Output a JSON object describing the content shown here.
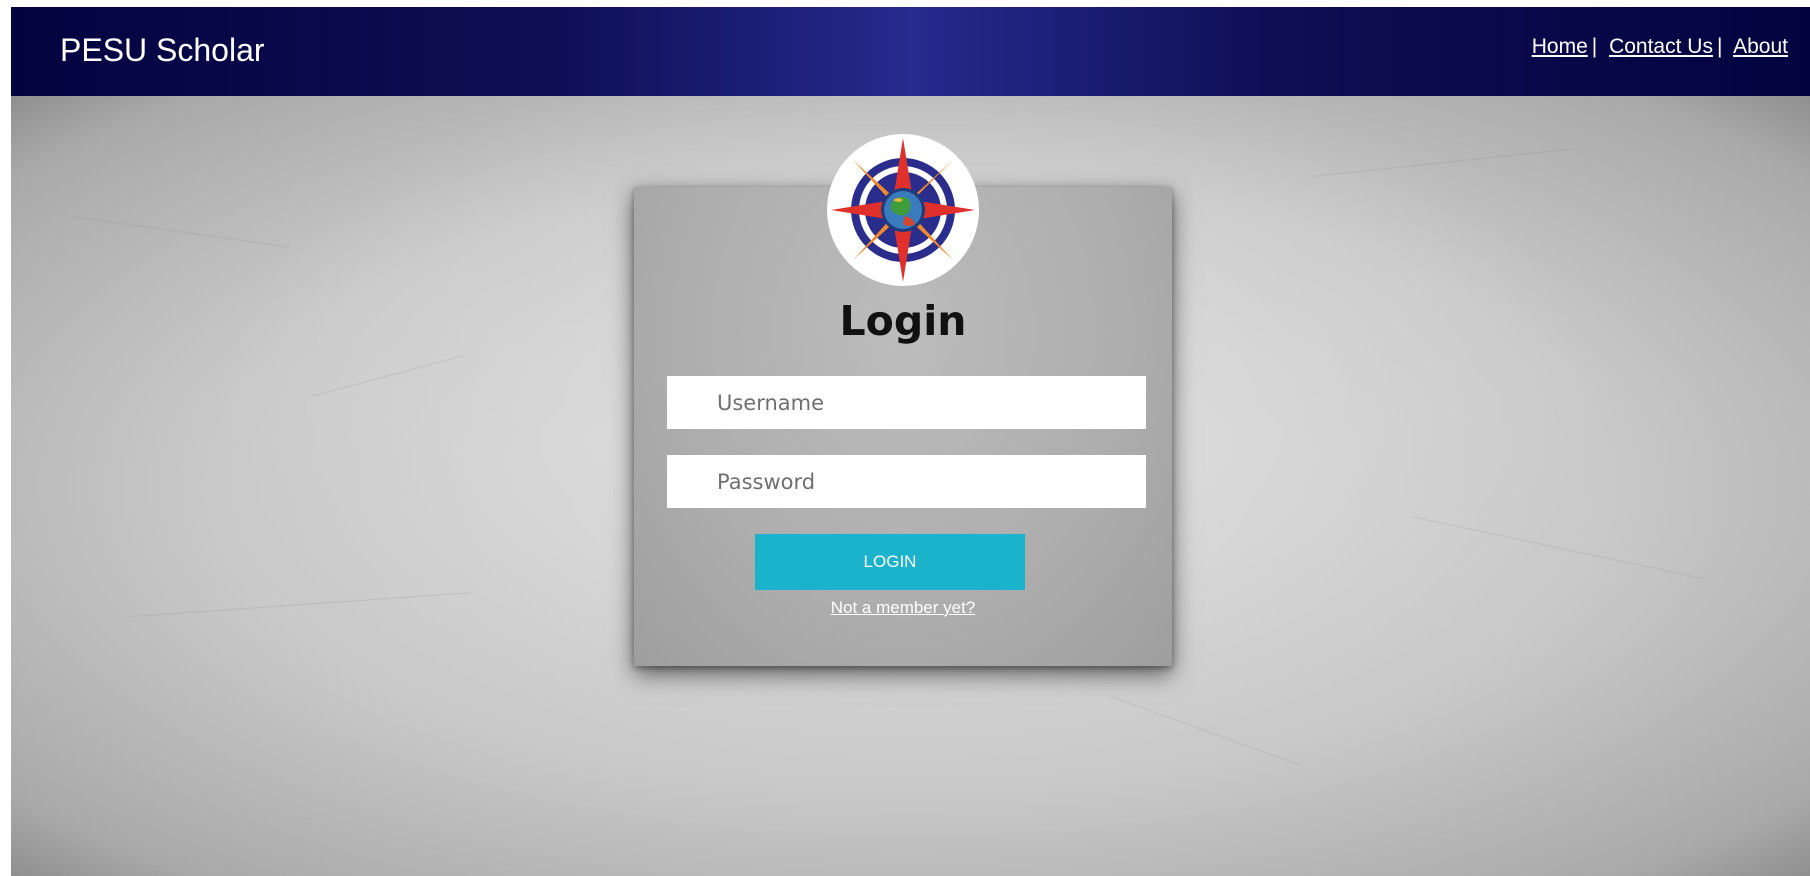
{
  "header": {
    "brand": "PESU Scholar",
    "nav": [
      {
        "label": "Home"
      },
      {
        "label": "Contact Us"
      },
      {
        "label": "About"
      }
    ],
    "separator": "|"
  },
  "login": {
    "logo": "compass-globe-logo",
    "title": "Login",
    "username": {
      "placeholder": "Username",
      "value": ""
    },
    "password": {
      "placeholder": "Password",
      "value": ""
    },
    "submit_label": "LOGIN",
    "register_link": "Not a member yet?"
  },
  "colors": {
    "navbar_dark": "#03033f",
    "navbar_light": "#272a8e",
    "button": "#1bb2cc",
    "background": "#c9c9c9",
    "panel": "#adadad"
  }
}
